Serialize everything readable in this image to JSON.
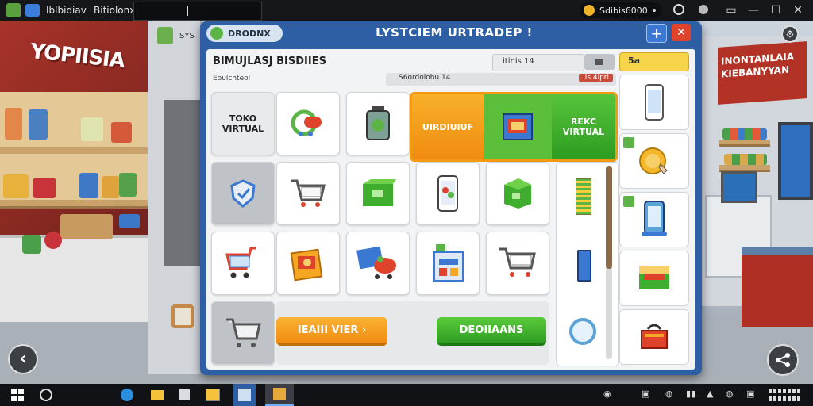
{
  "window": {
    "tab1_title": "Iblbidiav",
    "tab2_title": "Bitiolonx",
    "coin_balance": "Sdibis6000"
  },
  "scene": {
    "store_sign": "YOPIISIA",
    "right_sign_line1": "INONTANLAIA",
    "right_sign_line2": "KIEBANYYAN",
    "side_panel_label": "SYS"
  },
  "modal": {
    "logo_label": "DRODNX",
    "title": "LYSTCIEM URTRADEP !",
    "add_label": "+",
    "close_label": "✕",
    "subtitle": "BIMUJLASJ BISDIIES",
    "small_text": "Eoulchteol",
    "stat_label": "S6ordoiohu 14",
    "stat_value": "iis 4ipri",
    "search_value": "itinis 14",
    "gold_label": "5a",
    "toko_line1": "TOKO",
    "toko_line2": "VIRTUAL",
    "banner_orange": "UIRDIUIUF",
    "banner_green_line1": "REKC",
    "banner_green_line2": "VIRTUAL",
    "btn_orange": "IEAIII VIER ›",
    "btn_green": "DEOIIAANS"
  },
  "colors": {
    "modal_blue": "#2e5fa4",
    "accent_orange": "#f39a12",
    "accent_green": "#43b82c",
    "close_red": "#e0432b"
  },
  "icons": {
    "back": "back-arrow-icon",
    "share": "share-icon",
    "settings": "gear-icon"
  }
}
